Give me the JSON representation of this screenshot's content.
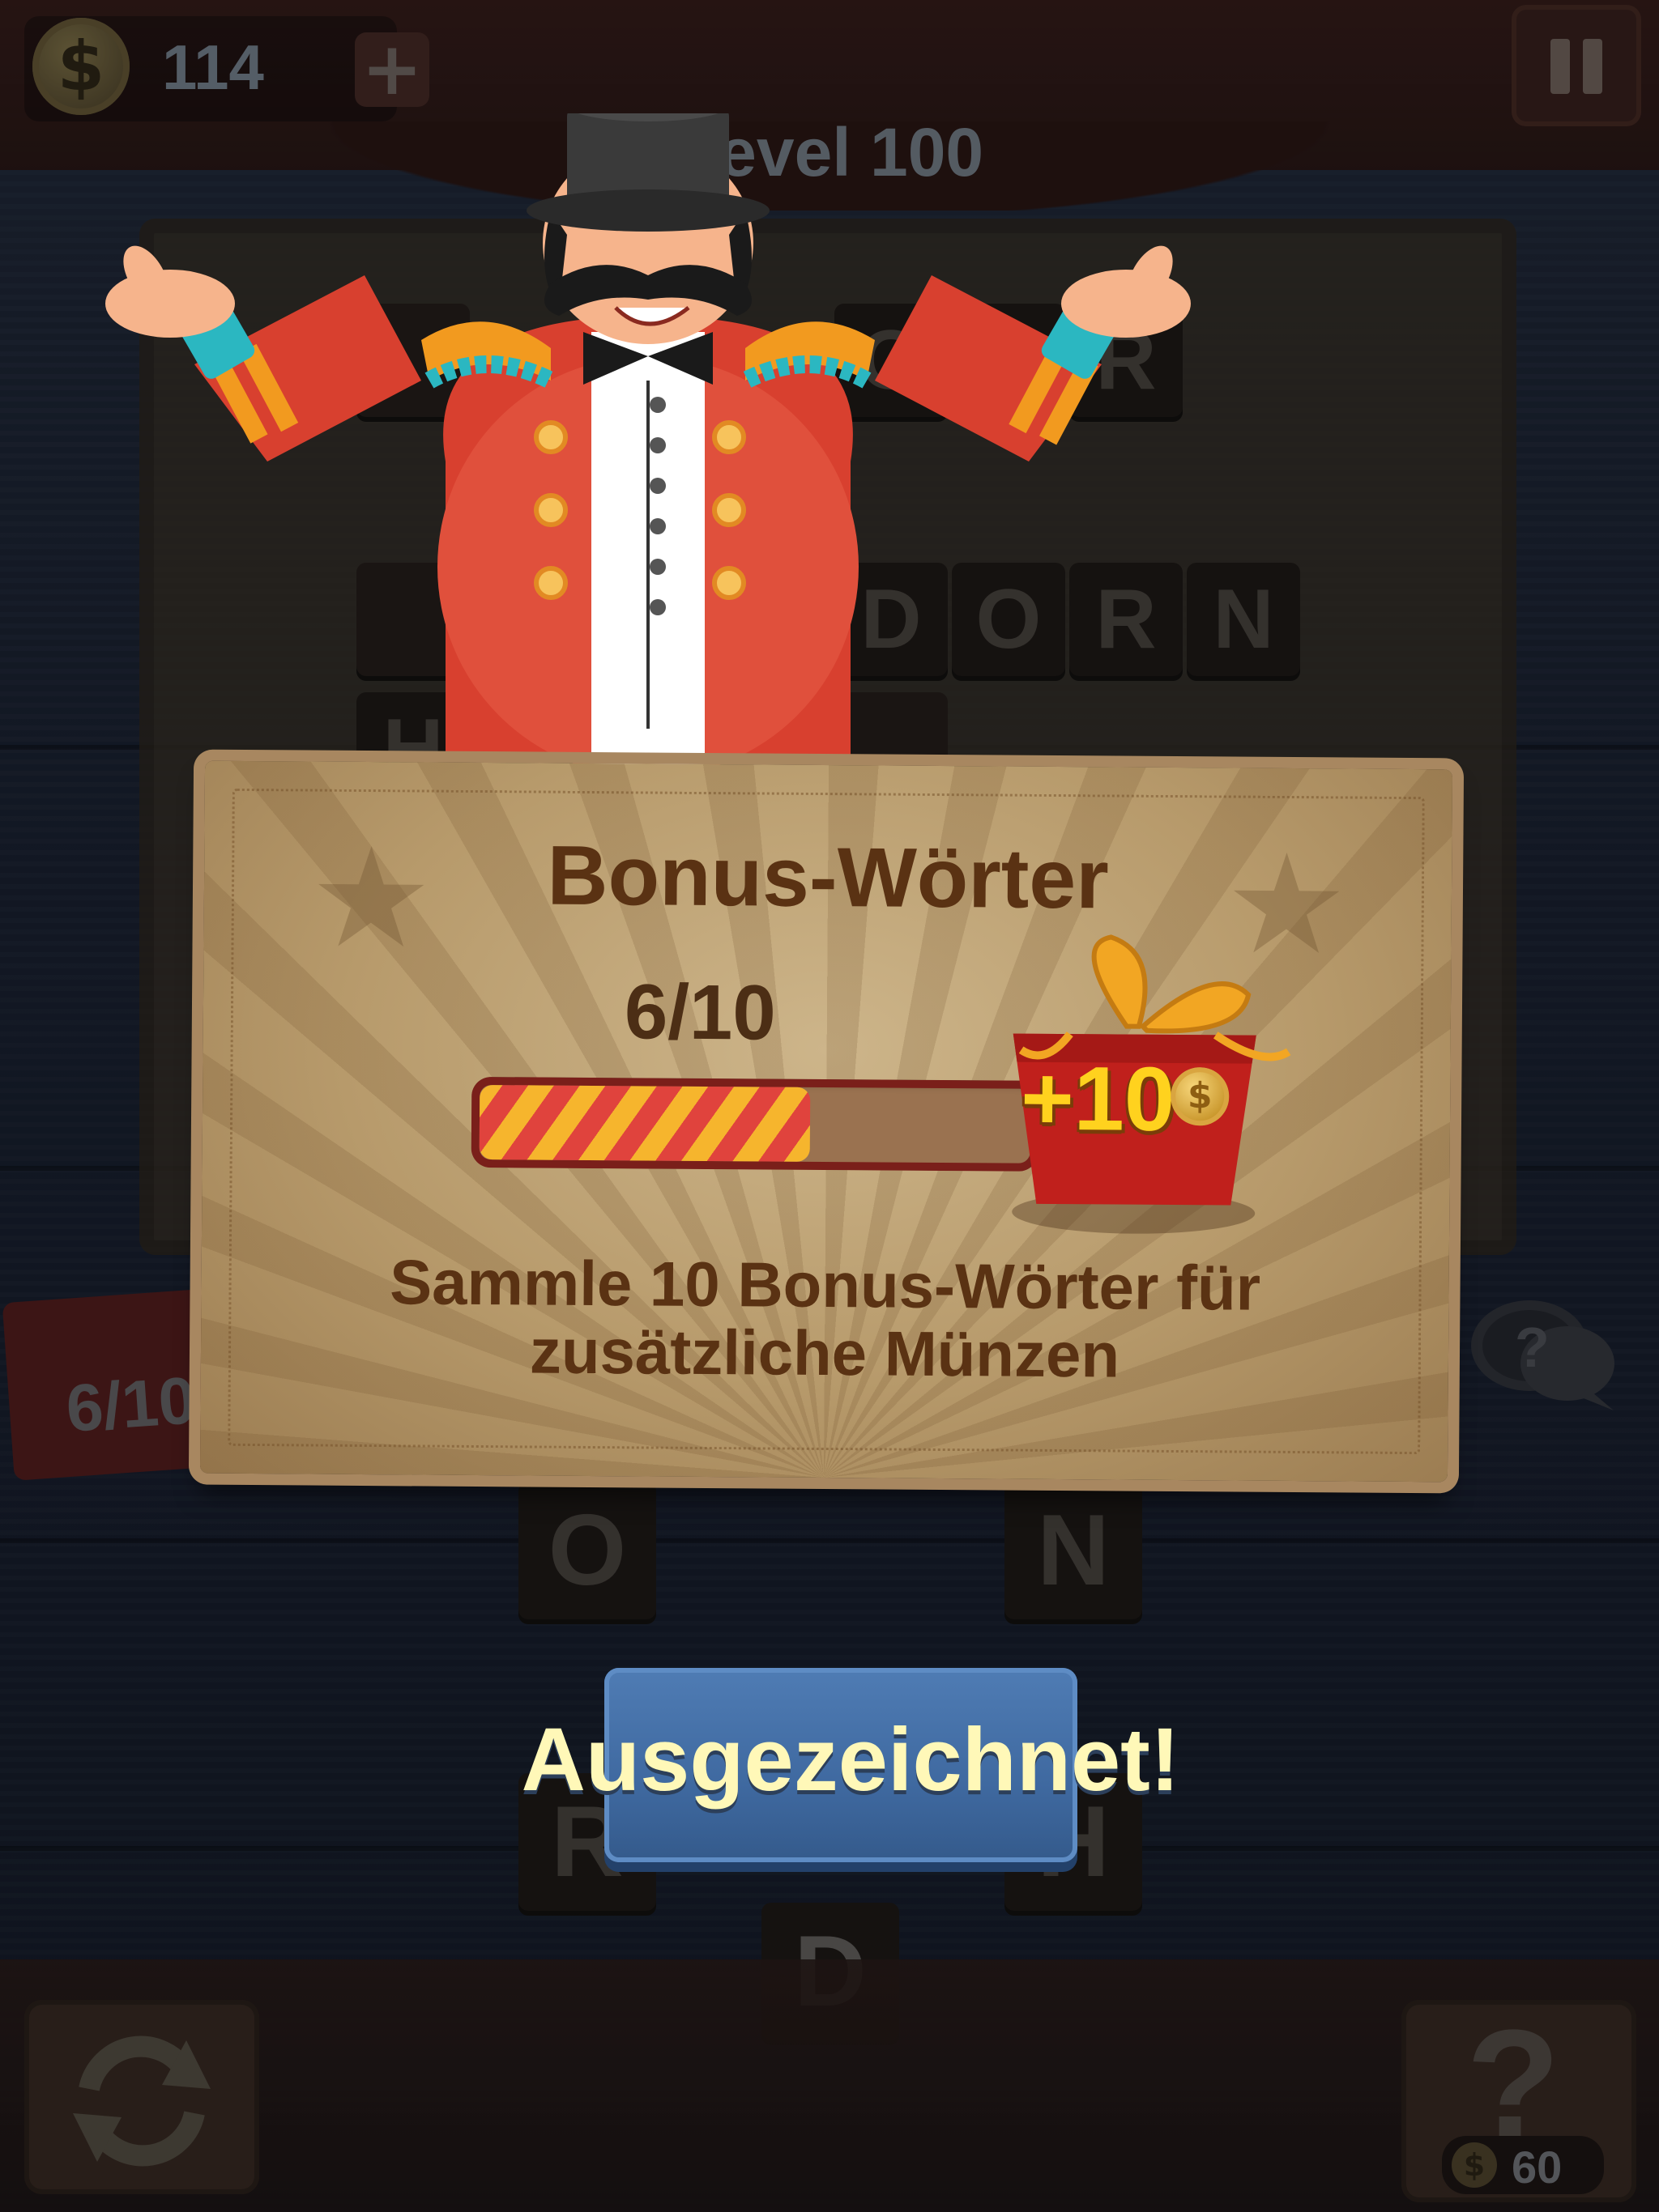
{
  "hud": {
    "coins": "114",
    "plus_label": "+",
    "level_title": "Level 100"
  },
  "board": {
    "row1": [
      "O",
      "",
      "R"
    ],
    "row2": [
      "D",
      "O",
      "R",
      "N"
    ],
    "partial_letter": "H"
  },
  "letter_wheel": {
    "letters": [
      "O",
      "N",
      "R",
      "H",
      "D"
    ]
  },
  "bonus_widget": {
    "progress": "6/10"
  },
  "dialog": {
    "title": "Bonus-Wörter",
    "progress_label": "6/10",
    "progress_current": 6,
    "progress_total": 10,
    "reward_label": "+10",
    "description": "Sammle 10 Bonus-Wörter für zusätzliche Münzen"
  },
  "action_button": {
    "label": "Ausgezeichnet!"
  },
  "hint": {
    "symbol": "?",
    "cost": "60"
  },
  "colors": {
    "parchment": "#c4a878",
    "title_brown": "#5a3213",
    "button_blue": "#4474ad",
    "button_text": "#fff8b8",
    "gift_red": "#c0201c",
    "gift_gold": "#ffd21e"
  },
  "icons": {
    "coin": "coin-icon",
    "pause": "pause-icon",
    "shuffle": "shuffle-icon",
    "hint": "question-icon",
    "chat": "chat-question-icon",
    "gift": "gift-icon"
  }
}
